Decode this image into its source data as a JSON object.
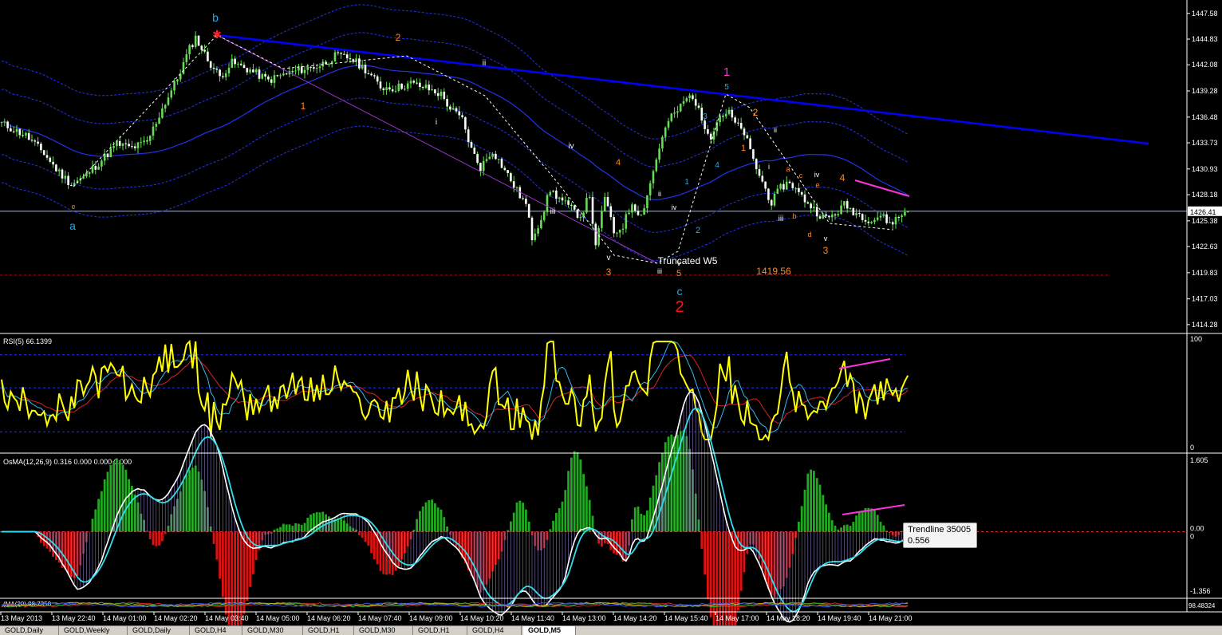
{
  "window": {
    "tabs": [
      {
        "label": "GOLD,Daily"
      },
      {
        "label": "GOLD,Weekly"
      },
      {
        "label": "GOLD,Daily"
      },
      {
        "label": "GOLD,H4"
      },
      {
        "label": "GOLD,M30"
      },
      {
        "label": "GOLD,H1"
      },
      {
        "label": "GOLD,M30"
      },
      {
        "label": "GOLD,H1"
      },
      {
        "label": "GOLD,H4"
      },
      {
        "label": "GOLD,M5"
      }
    ],
    "active_tab": 9
  },
  "colors": {
    "background": "#000000",
    "candle": "#66dd55",
    "trendline": "#0000ff",
    "pink": "#ff33dd",
    "purple": "#9933cc",
    "rsi": "#ffff00",
    "osma_pos": "#1faa1f",
    "osma_neg": "#dd1111",
    "macd": "#ffffff",
    "signal": "#33ddee",
    "support": "#cc0000"
  },
  "chart_data": [
    {
      "type": "candlestick",
      "symbol": "GOLD",
      "timeframe": "M5",
      "ylim": [
        1413.5,
        1448.5
      ],
      "y_ticks": [
        1447.58,
        1444.83,
        1442.08,
        1439.28,
        1436.48,
        1433.73,
        1430.93,
        1428.18,
        1426.41,
        1425.38,
        1422.63,
        1419.83,
        1417.03,
        1414.28
      ],
      "current_price": 1426.41,
      "x_ticks": [
        "13 May 2013",
        "13 May 22:40",
        "14 May 01:00",
        "14 May 02:20",
        "14 May 03:40",
        "14 May 05:00",
        "14 May 06:20",
        "14 May 07:40",
        "14 May 09:00",
        "14 May 10:20",
        "14 May 11:40",
        "14 May 13:00",
        "14 May 14:20",
        "14 May 15:40",
        "14 May 17:00",
        "14 May 18:20",
        "14 May 19:40",
        "14 May 21:00"
      ],
      "price_path": [
        [
          0,
          1435.8
        ],
        [
          8,
          1434.5
        ],
        [
          14,
          1432.6
        ],
        [
          18,
          1430.9
        ],
        [
          23,
          1429.3
        ],
        [
          27,
          1430.0
        ],
        [
          33,
          1431.9
        ],
        [
          38,
          1433.6
        ],
        [
          43,
          1433.2
        ],
        [
          48,
          1433.8
        ],
        [
          53,
          1437.4
        ],
        [
          58,
          1440.6
        ],
        [
          62,
          1443.8
        ],
        [
          64,
          1445.0
        ],
        [
          68,
          1442.6
        ],
        [
          72,
          1440.8
        ],
        [
          76,
          1442.3
        ],
        [
          82,
          1441.5
        ],
        [
          88,
          1440.4
        ],
        [
          92,
          1440.9
        ],
        [
          98,
          1441.5
        ],
        [
          105,
          1442.0
        ],
        [
          110,
          1443.0
        ],
        [
          115,
          1442.8
        ],
        [
          120,
          1441.6
        ],
        [
          125,
          1439.7
        ],
        [
          130,
          1439.6
        ],
        [
          135,
          1440.1
        ],
        [
          140,
          1439.6
        ],
        [
          145,
          1438.9
        ],
        [
          148,
          1437.4
        ],
        [
          152,
          1436.2
        ],
        [
          155,
          1433.0
        ],
        [
          158,
          1431.1
        ],
        [
          162,
          1432.9
        ],
        [
          166,
          1430.8
        ],
        [
          170,
          1428.6
        ],
        [
          173,
          1427.1
        ],
        [
          175,
          1423.6
        ],
        [
          178,
          1425.7
        ],
        [
          181,
          1428.7
        ],
        [
          184,
          1427.8
        ],
        [
          188,
          1426.6
        ],
        [
          191,
          1425.9
        ],
        [
          194,
          1428.2
        ],
        [
          196,
          1422.4
        ],
        [
          199,
          1428.1
        ],
        [
          202,
          1424.0
        ],
        [
          205,
          1424.9
        ],
        [
          208,
          1427.3
        ],
        [
          211,
          1425.9
        ],
        [
          214,
          1429.4
        ],
        [
          217,
          1433.3
        ],
        [
          220,
          1436.1
        ],
        [
          223,
          1437.2
        ],
        [
          226,
          1438.5
        ],
        [
          228,
          1438.8
        ],
        [
          231,
          1436.2
        ],
        [
          234,
          1434.5
        ],
        [
          237,
          1436.7
        ],
        [
          240,
          1436.9
        ],
        [
          242,
          1435.8
        ],
        [
          245,
          1434.8
        ],
        [
          248,
          1431.8
        ],
        [
          251,
          1429.5
        ],
        [
          254,
          1427.3
        ],
        [
          257,
          1428.9
        ],
        [
          260,
          1429.6
        ],
        [
          263,
          1428.3
        ],
        [
          266,
          1427.3
        ],
        [
          269,
          1426.3
        ],
        [
          272,
          1425.6
        ],
        [
          275,
          1426.1
        ],
        [
          278,
          1427.1
        ],
        [
          281,
          1426.4
        ],
        [
          284,
          1425.9
        ],
        [
          287,
          1425.4
        ],
        [
          290,
          1426.0
        ],
        [
          293,
          1425.1
        ],
        [
          296,
          1425.8
        ],
        [
          299,
          1426.6
        ]
      ],
      "wave_labels": [
        {
          "text": "b",
          "color": "#22aaee"
        },
        {
          "text": "a",
          "color": "#22aaee"
        },
        {
          "text": "e",
          "color": "#cc8800"
        },
        {
          "text": "2",
          "color": "#ff8822"
        },
        {
          "text": "1",
          "color": "#ff8822"
        },
        {
          "text": "ii",
          "color": "#ffffff"
        },
        {
          "text": "i",
          "color": "#ffffff"
        },
        {
          "text": "iv",
          "color": "#ffffff"
        },
        {
          "text": "iii",
          "color": "#ffffff"
        },
        {
          "text": "4",
          "color": "#ff8822"
        },
        {
          "text": "v",
          "color": "#ffffff"
        },
        {
          "text": "3",
          "color": "#ff8822"
        },
        {
          "text": "ii",
          "color": "#ffffff"
        },
        {
          "text": "iv",
          "color": "#ffffff"
        },
        {
          "text": "iii",
          "color": "#ffffff"
        },
        {
          "text": "v",
          "color": "#ffffff"
        },
        {
          "text": "5",
          "color": "#ff8822"
        },
        {
          "text": "c",
          "color": "#22aaee"
        },
        {
          "text": "2",
          "color": "#ff1111"
        },
        {
          "text": "Truncated W5",
          "color": "#ffffff"
        },
        {
          "text": "1",
          "color": "#22aaee"
        },
        {
          "text": "2",
          "color": "#22aaee"
        },
        {
          "text": "3",
          "color": "#22aaee"
        },
        {
          "text": "4",
          "color": "#22aaee"
        },
        {
          "text": "5",
          "color": "#22aaee"
        },
        {
          "text": "1",
          "color": "#ff33cc"
        },
        {
          "text": "2",
          "color": "#ff8822"
        },
        {
          "text": "1",
          "color": "#ff8822"
        },
        {
          "text": "ii",
          "color": "#ffffff"
        },
        {
          "text": "i",
          "color": "#ffffff"
        },
        {
          "text": "a",
          "color": "#ff8822"
        },
        {
          "text": "c",
          "color": "#ff8822"
        },
        {
          "text": "e",
          "color": "#ff8822"
        },
        {
          "text": "iv",
          "color": "#ffffff"
        },
        {
          "text": "4",
          "color": "#ff8822"
        },
        {
          "text": "iii",
          "color": "#ffffff"
        },
        {
          "text": "b",
          "color": "#ff8822"
        },
        {
          "text": "d",
          "color": "#ff8822"
        },
        {
          "text": "v",
          "color": "#ffffff"
        },
        {
          "text": "3",
          "color": "#ff8822"
        },
        {
          "text": "1419.56",
          "color": "#ff8822"
        }
      ],
      "support_level": 1419.56
    },
    {
      "type": "line",
      "name": "RSI(5) 66.1399",
      "ylim": [
        0,
        100
      ],
      "y_ticks": [
        "100",
        "0"
      ],
      "last_value": 66.1399
    },
    {
      "type": "bar",
      "name": "OsMA(12,26,9) 0.316 0.000 0.000 0.000",
      "ylim": [
        -1.356,
        1.605
      ],
      "y_ticks": [
        "1.605",
        "0.00",
        "0",
        "-1.356"
      ],
      "tooltip": {
        "title": "Trendline 35005",
        "value": "0.556"
      }
    },
    {
      "type": "line",
      "name": "(MA(20) 98.7350",
      "y_ticks": [
        "98.48324"
      ]
    }
  ]
}
